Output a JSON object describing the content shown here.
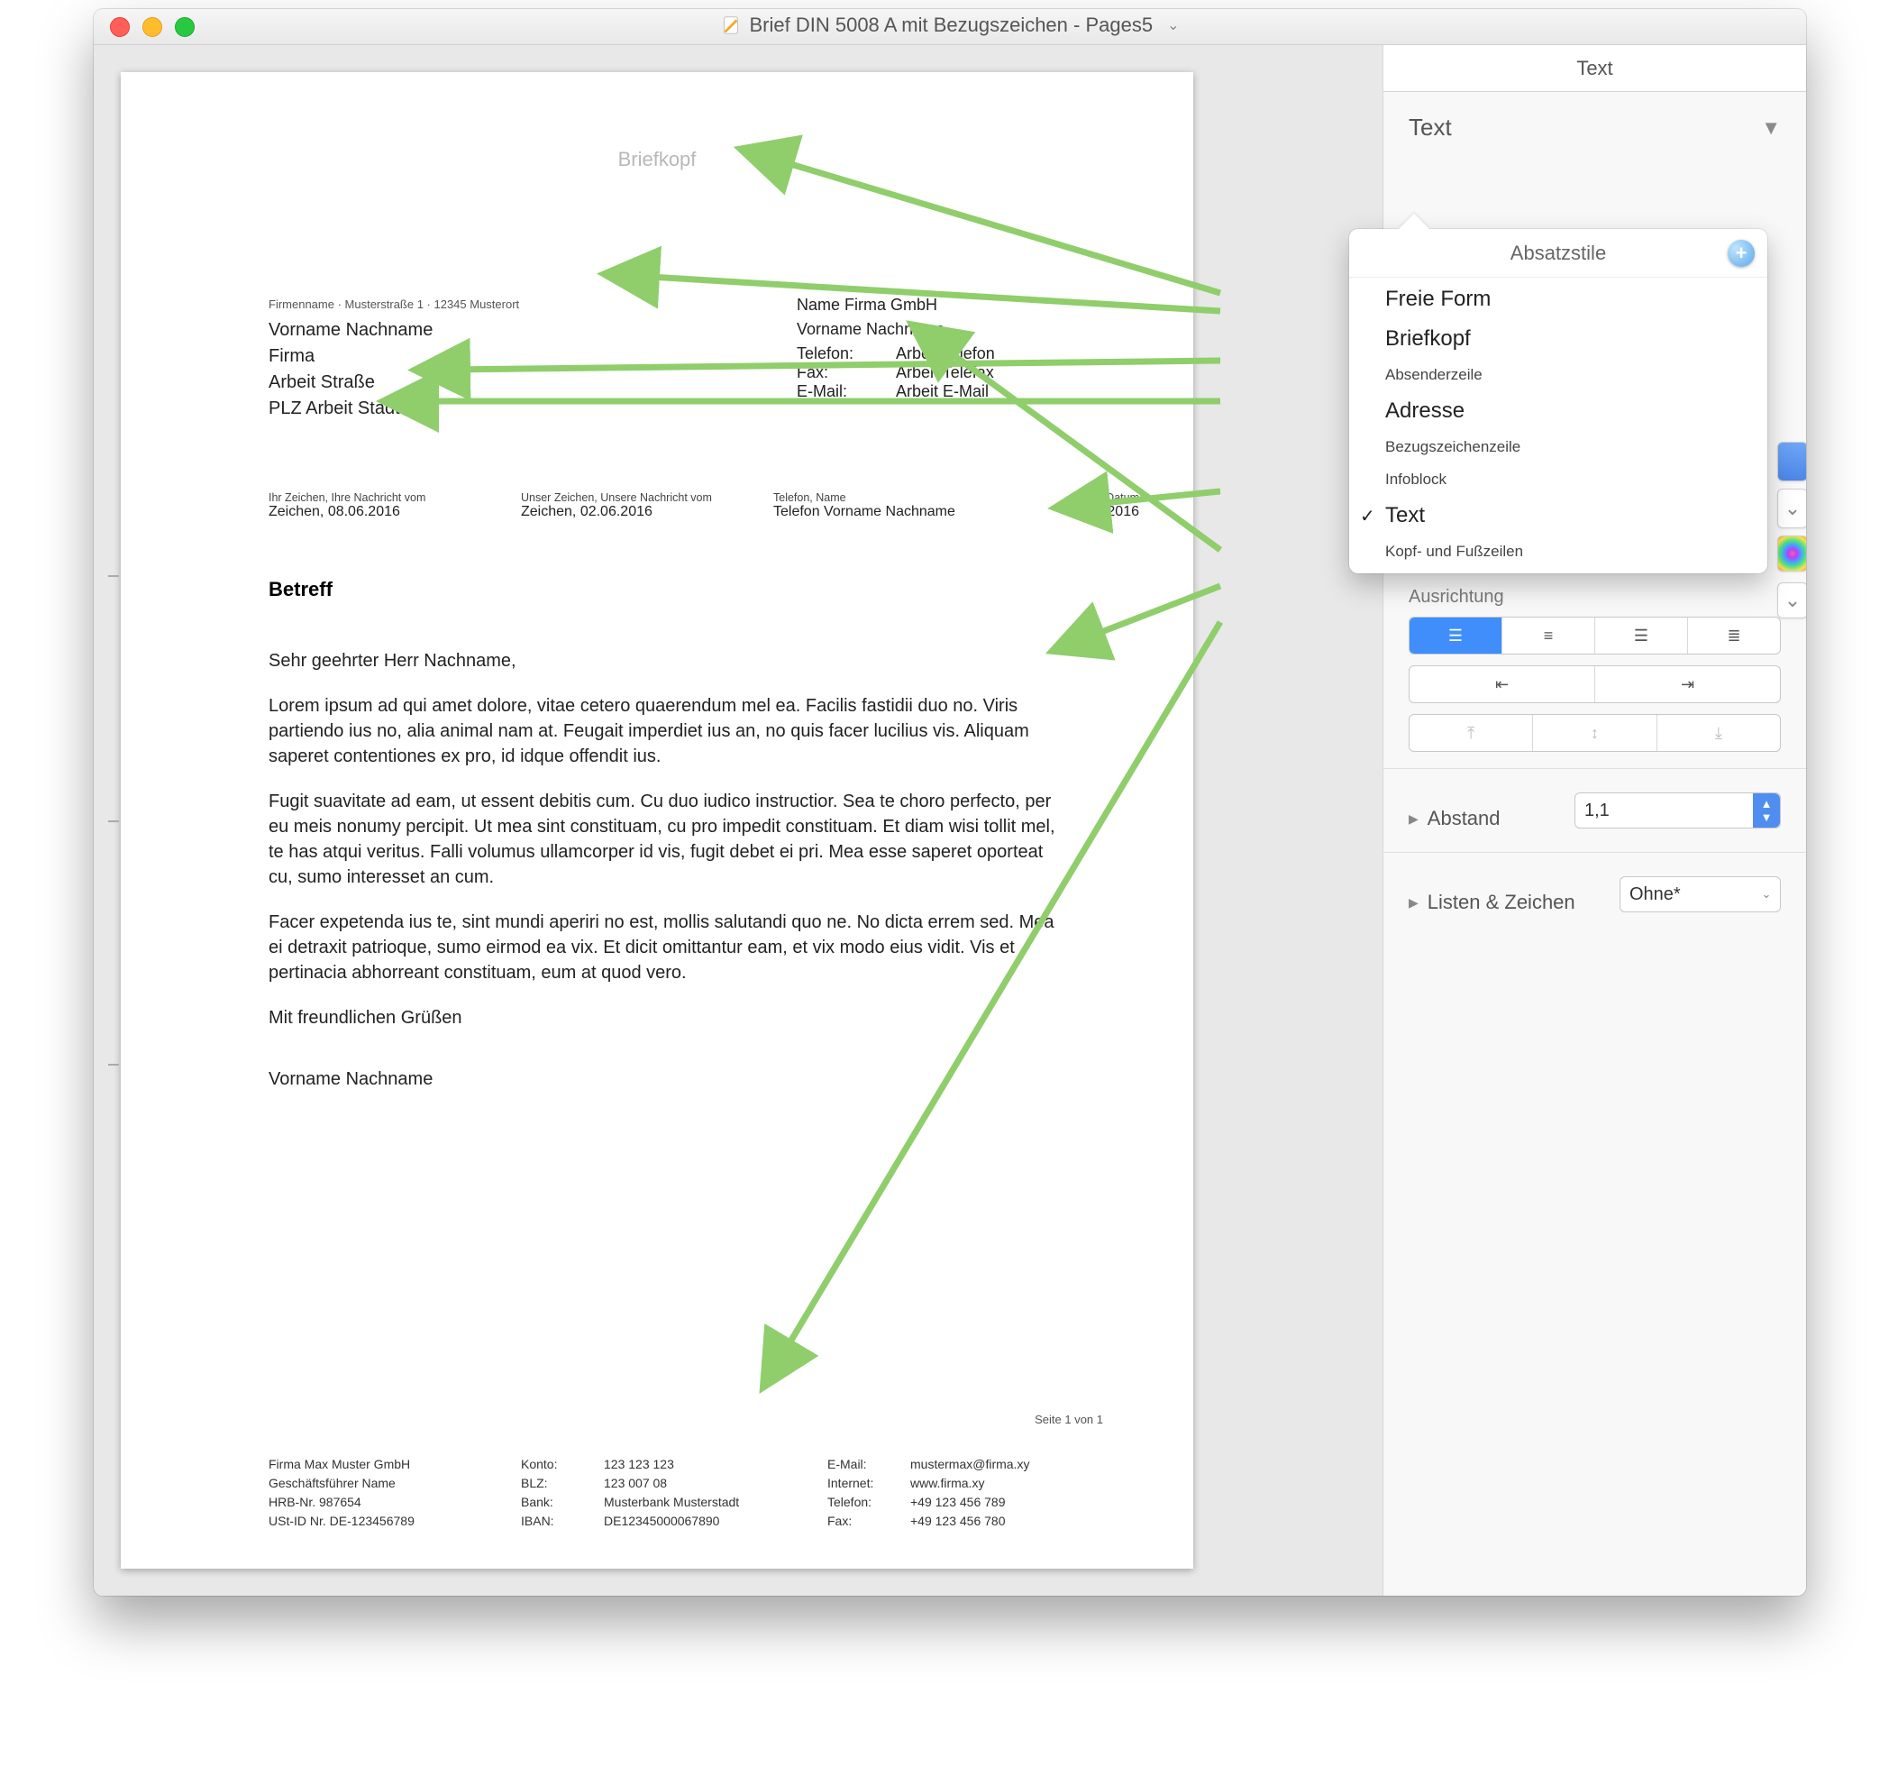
{
  "window": {
    "title": "Brief DIN 5008 A mit Bezugszeichen - Pages5"
  },
  "document": {
    "briefkopf_placeholder": "Briefkopf",
    "absenderzeile": "Firmenname · Musterstraße 1 · 12345 Musterort",
    "adresse": {
      "l1": "Vorname Nachname",
      "l2": "Firma",
      "l3": "Arbeit Straße",
      "l4": "PLZ Arbeit Stadt"
    },
    "infoblock": {
      "head1": "Name Firma GmbH",
      "head2": "Vorname Nachname",
      "rows": [
        {
          "label": "Telefon:",
          "value": "Arbeit Telefon"
        },
        {
          "label": "Fax:",
          "value": "Arbeit Telefax"
        },
        {
          "label": "E-Mail:",
          "value": "Arbeit E-Mail"
        }
      ]
    },
    "bezug": {
      "c1h": "Ihr Zeichen, Ihre Nachricht vom",
      "c1v": "Zeichen, 08.06.2016",
      "c2h": "Unser Zeichen, Unsere Nachricht vom",
      "c2v": "Zeichen, 02.06.2016",
      "c3h": "Telefon, Name",
      "c3v": "Telefon Vorname Nachname",
      "c4h": "Datum",
      "c4v": "15.06.2016"
    },
    "betreff": "Betreff",
    "anrede": "Sehr geehrter Herr Nachname,",
    "para1": "Lorem ipsum ad qui amet dolore, vitae cetero quaerendum mel ea. Facilis fastidii duo no. Viris partiendo ius no, alia animal nam at. Feugait imperdiet ius an, no quis facer lucilius vis. Aliquam saperet contentiones ex pro, id idque offendit ius.",
    "para2": "Fugit suavitate ad eam, ut essent debitis cum. Cu duo iudico instructior. Sea te choro perfecto, per eu meis nonumy percipit. Ut mea sint constituam, cu pro impedit constituam. Et diam wisi tollit mel, te has atqui veritus. Falli volumus ullamcorper id vis, fugit debet ei pri. Mea esse saperet oporteat cu, sumo interesset an cum.",
    "para3": "Facer expetenda ius te, sint mundi aperiri no est, mollis salutandi quo ne. No dicta errem sed. Mea ei detraxit patrioque, sumo eirmod ea vix. Et dicit omittantur eam, et vix modo eius vidit. Vis et pertinacia abhorreant constituam, eum at quod vero.",
    "gruss": "Mit freundlichen Grüßen",
    "signature": "Vorname Nachname",
    "page_footer_num": "Seite 1 von 1",
    "footer": {
      "col1": {
        "l1": "Firma Max Muster GmbH",
        "l2": "Geschäftsführer Name",
        "l3": "HRB-Nr. 987654",
        "l4": "USt-ID Nr. DE-123456789"
      },
      "col2": [
        {
          "label": "Konto:",
          "value": "123 123 123"
        },
        {
          "label": "BLZ:",
          "value": "123 007 08"
        },
        {
          "label": "Bank:",
          "value": "Musterbank Musterstadt"
        },
        {
          "label": "IBAN:",
          "value": "DE12345000067890"
        }
      ],
      "col3": [
        {
          "label": "E-Mail:",
          "value": "mustermax@firma.xy"
        },
        {
          "label": "Internet:",
          "value": "www.firma.xy"
        },
        {
          "label": "Telefon:",
          "value": "+49 123 456 789"
        },
        {
          "label": "Fax:",
          "value": "+49 123 456 780"
        }
      ]
    }
  },
  "inspector": {
    "tab_label": "Text",
    "style_name": "Text",
    "popover": {
      "title": "Absatzstile",
      "items": [
        {
          "label": "Freie Form",
          "size": "big"
        },
        {
          "label": "Briefkopf",
          "size": "big"
        },
        {
          "label": "Absenderzeile",
          "size": "small"
        },
        {
          "label": "Adresse",
          "size": "big"
        },
        {
          "label": "Bezugszeichenzeile",
          "size": "small"
        },
        {
          "label": "Infoblock",
          "size": "small"
        },
        {
          "label": "Text",
          "size": "big",
          "checked": true
        },
        {
          "label": "Kopf- und Fußzeilen",
          "size": "small"
        }
      ]
    },
    "section_align": "Ausrichtung",
    "section_spacing": "Abstand",
    "spacing_value": "1,1",
    "section_list": "Listen & Zeichen",
    "list_value": "Ohne*"
  }
}
